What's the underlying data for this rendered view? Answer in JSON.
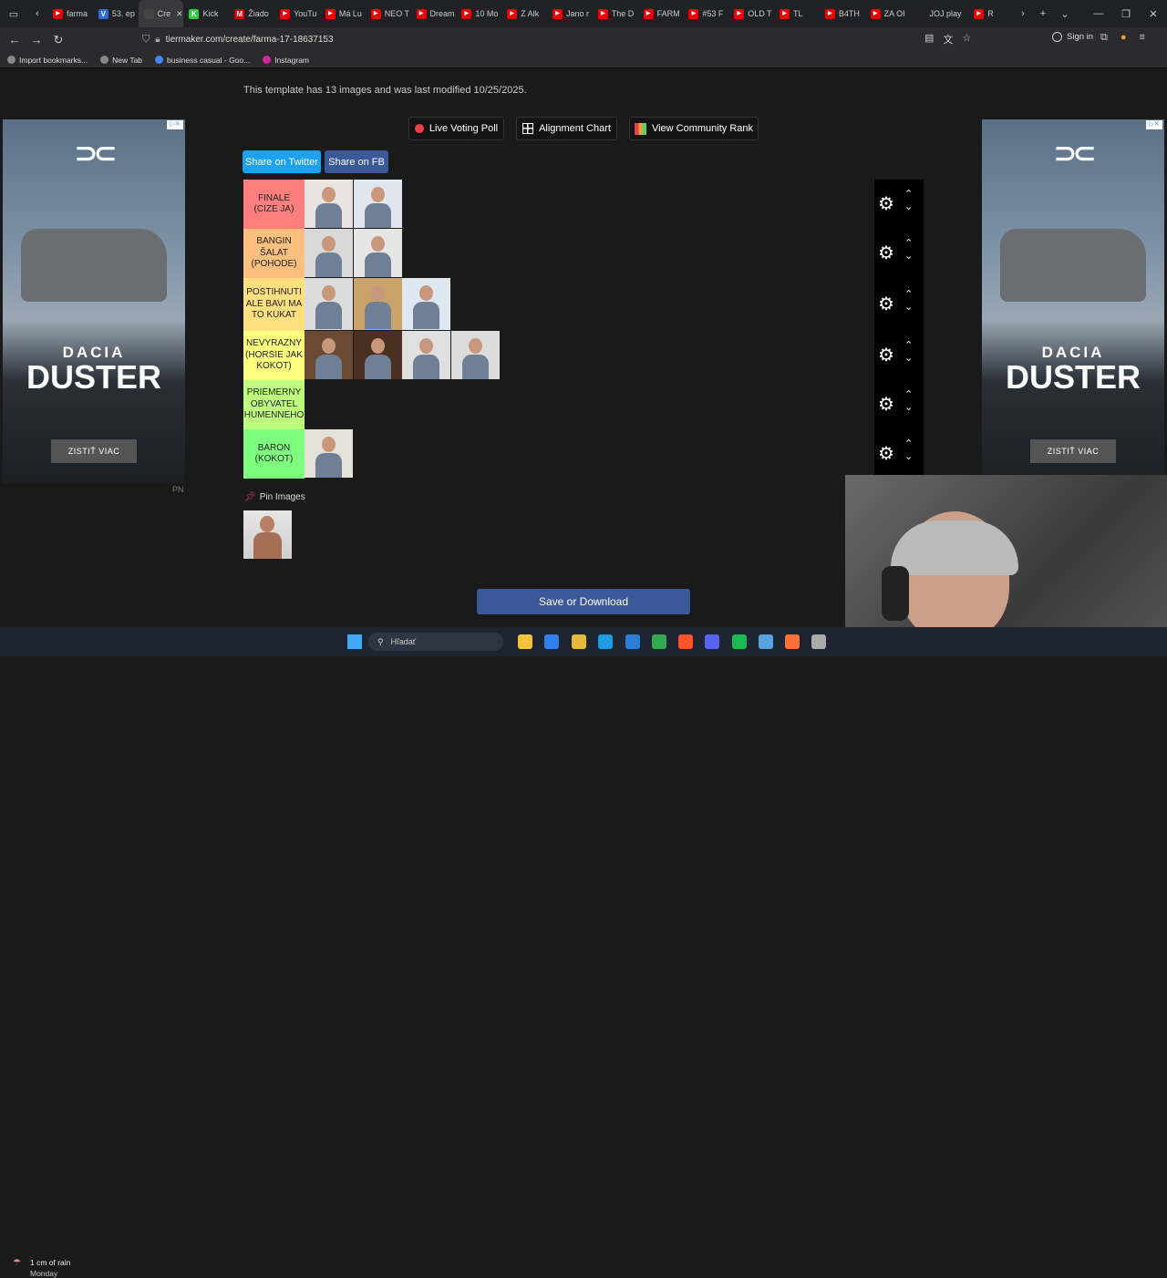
{
  "tabs": [
    {
      "title": "farma",
      "color": "#e00"
    },
    {
      "title": "53. ep",
      "color": "#2b6cd3",
      "letter": "V"
    },
    {
      "title": "Cre",
      "color": "#444",
      "active": true
    },
    {
      "title": "Kick",
      "color": "#2ecc40",
      "letter": "K"
    },
    {
      "title": "Žiado",
      "color": "#c00",
      "letter": "M"
    },
    {
      "title": "YouTu",
      "color": "#e00"
    },
    {
      "title": "Má Lu",
      "color": "#e00"
    },
    {
      "title": "NEO T",
      "color": "#e00"
    },
    {
      "title": "Dream",
      "color": "#e00"
    },
    {
      "title": "10 Mo",
      "color": "#e00"
    },
    {
      "title": "Z Alk",
      "color": "#e00"
    },
    {
      "title": "Jano r",
      "color": "#e00"
    },
    {
      "title": "The D",
      "color": "#e00"
    },
    {
      "title": "FARM",
      "color": "#e00"
    },
    {
      "title": "#53 F",
      "color": "#e00"
    },
    {
      "title": "OLD T",
      "color": "#e00"
    },
    {
      "title": "TL",
      "color": "#e00"
    },
    {
      "title": "B4TH",
      "color": "#e00"
    },
    {
      "title": "ZA OI",
      "color": "#e00"
    },
    {
      "title": "JOJ play",
      "color": "#222"
    },
    {
      "title": "R",
      "color": "#e00"
    }
  ],
  "url": "tiermaker.com/create/farma-17-18637153",
  "signin": "Sign in",
  "bookmarks": [
    {
      "label": "Import bookmarks...",
      "color": "#888"
    },
    {
      "label": "New Tab",
      "color": "#888"
    },
    {
      "label": "business casual - Goo...",
      "color": "#4285f4"
    },
    {
      "label": "Instagram",
      "color": "#d6249f"
    }
  ],
  "info_text": "This template has 13 images and was last modified 10/25/2025.",
  "buttons": {
    "live_voting": "Live Voting Poll",
    "alignment": "Alignment Chart",
    "community": "View Community Rank",
    "twitter": "Share on Twitter",
    "fb": "Share on FB",
    "save": "Save or Download"
  },
  "tiers": [
    {
      "label": "FINALE (CIZE JA)",
      "color": "#ff7f7f",
      "images": 2
    },
    {
      "label": "BANGIN ŠALAT (POHODE)",
      "color": "#ffbf7f",
      "images": 2
    },
    {
      "label": "POSTIHNUTI ALE BAVI MA TO KUKAT",
      "color": "#ffdf7f",
      "images": 3
    },
    {
      "label": "NEVYRAZNY (HORSIE JAK KOKOT)",
      "color": "#ffff7f",
      "images": 4
    },
    {
      "label": "PRIEMERNY OBYVATEL HUMENNEHO",
      "color": "#bfff7f",
      "images": 0
    },
    {
      "label": "BARON (KOKOT)",
      "color": "#7fff7f",
      "images": 1
    }
  ],
  "pin_images": "Pin Images",
  "ad": {
    "brand": "DUSTER",
    "sub": "DACIA",
    "cta": "ZISTIŤ VIAC",
    "tag": "PN"
  },
  "taskbar": {
    "weather": "1 cm of rain",
    "day": "Monday",
    "search": "Hľadať"
  }
}
